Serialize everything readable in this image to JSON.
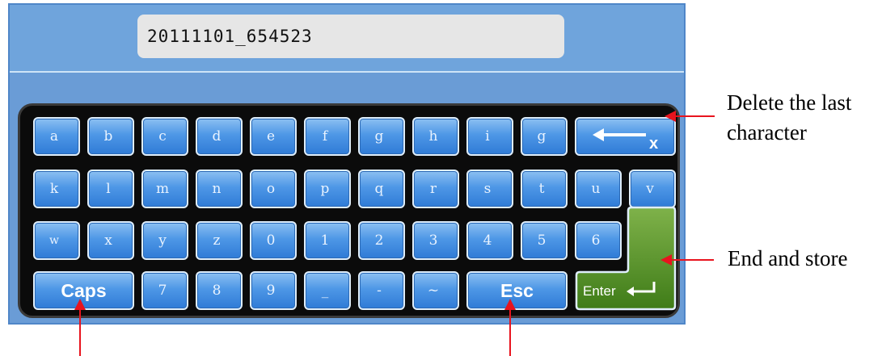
{
  "filename": "20111101_654523",
  "keyboard": {
    "row1": [
      "a",
      "b",
      "c",
      "d",
      "e",
      "f",
      "g",
      "h",
      "i",
      "g"
    ],
    "row2": [
      "k",
      "l",
      "m",
      "n",
      "o",
      "p",
      "q",
      "r",
      "s",
      "t",
      "u",
      "v"
    ],
    "row3": [
      "w",
      "x",
      "y",
      "z",
      "0",
      "1",
      "2",
      "3",
      "4",
      "5",
      "6"
    ],
    "row4_mid": [
      "7",
      "8",
      "9",
      "_",
      "-",
      "~"
    ],
    "backspace_icon": "backspace-arrow",
    "backspace_label": "x",
    "caps_label": "Caps",
    "esc_label": "Esc",
    "enter_label": "Enter"
  },
  "annotations": {
    "delete_line1": "Delete the last",
    "delete_line2": "character",
    "end_store": "End and store"
  },
  "colors": {
    "panel": "#6a9cd6",
    "key": "#3d8ae0",
    "enter": "#4e8a1f",
    "arrow": "#e8141e"
  }
}
